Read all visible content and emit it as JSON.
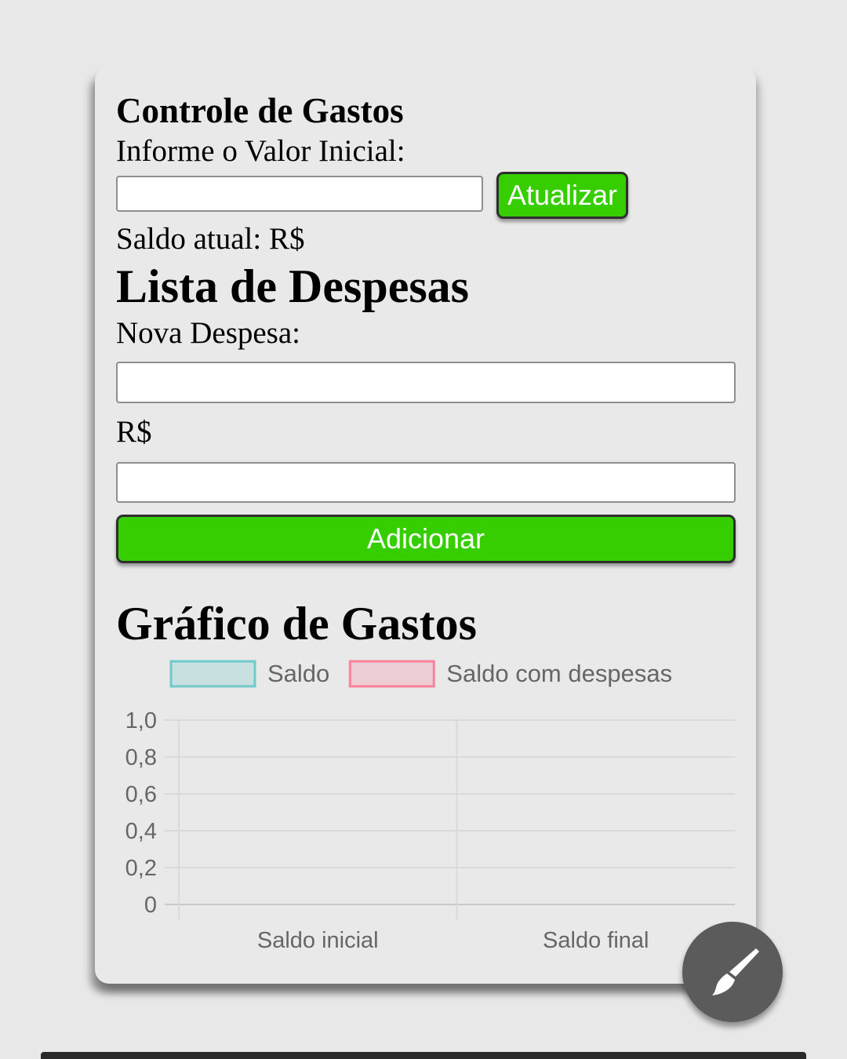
{
  "header": {
    "title": "Controle de Gastos"
  },
  "initial_value": {
    "label": "Informe o Valor Inicial:",
    "value": "",
    "update_label": "Atualizar"
  },
  "balance": {
    "label": "Saldo atual: R$"
  },
  "expenses": {
    "title": "Lista de Despesas",
    "new_label": "Nova Despesa:",
    "description_value": "",
    "currency_label": "R$",
    "amount_value": "",
    "add_label": "Adicionar"
  },
  "chart_section": {
    "title": "Gráfico de Gastos"
  },
  "chart_data": {
    "type": "bar",
    "categories": [
      "Saldo inicial",
      "Saldo final"
    ],
    "series": [
      {
        "name": "Saldo",
        "values": [],
        "color": "#4bc0c0"
      },
      {
        "name": "Saldo com despesas",
        "values": [],
        "color": "#ff6384"
      }
    ],
    "yticks": [
      "0",
      "0,2",
      "0,4",
      "0,6",
      "0,8",
      "1,0"
    ],
    "ylim": [
      0,
      1
    ],
    "grid": true,
    "legend": "top"
  },
  "fab": {
    "icon": "brush-icon"
  },
  "colors": {
    "accent": "#36ce00",
    "background": "#e8e8e8",
    "fab": "#5b5b5b"
  }
}
